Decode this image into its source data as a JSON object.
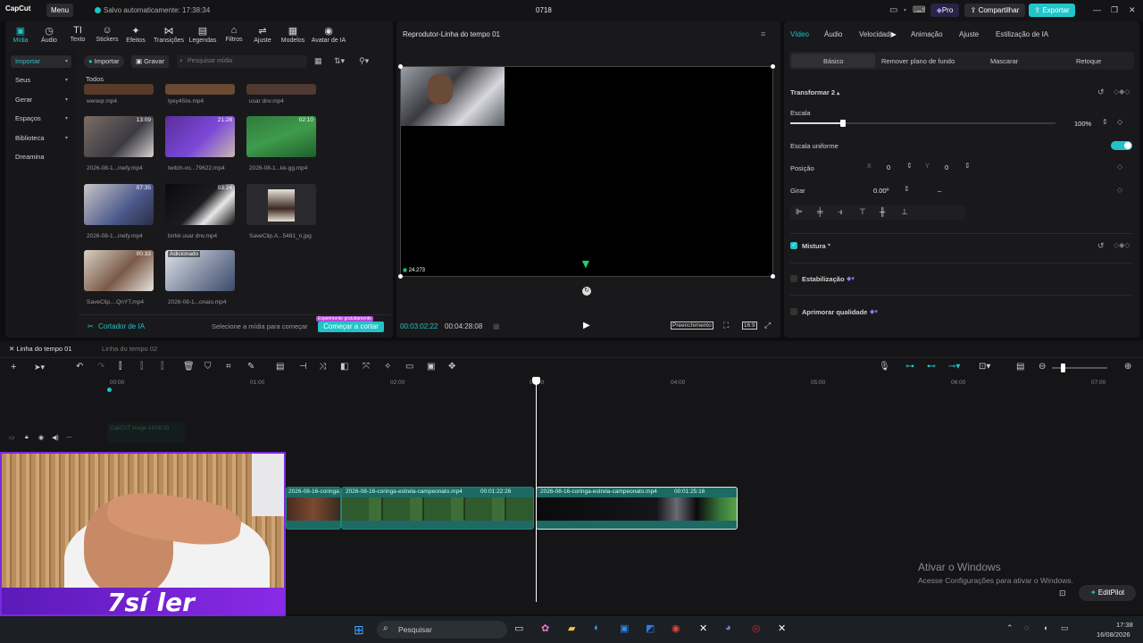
{
  "titlebar": {
    "logo": "CapCut",
    "menu_label": "Menu",
    "autosave": "Salvo automaticamente: 17:38:34",
    "doc_title": "0718",
    "pro_label": "Pro",
    "share_label": "Compartilhar",
    "export_label": "Exportar",
    "accent": "#22c6c9"
  },
  "tools": [
    {
      "label": "Mídia",
      "icon": "media-icon"
    },
    {
      "label": "Áudio",
      "icon": "audio-icon"
    },
    {
      "label": "Texto",
      "icon": "text-icon"
    },
    {
      "label": "Stickers",
      "icon": "sticker-icon"
    },
    {
      "label": "Efeitos",
      "icon": "effects-icon"
    },
    {
      "label": "Transições",
      "icon": "transitions-icon"
    },
    {
      "label": "Legendas",
      "icon": "captions-icon"
    },
    {
      "label": "Filtros",
      "icon": "filters-icon"
    },
    {
      "label": "Ajuste",
      "icon": "adjust-icon"
    },
    {
      "label": "Modelos",
      "icon": "templates-icon"
    },
    {
      "label": "Avatar de IA",
      "icon": "avatar-icon"
    }
  ],
  "categories": [
    "Importar",
    "Seus",
    "Gerar",
    "Espaços",
    "Biblioteca",
    "Dreamina"
  ],
  "media": {
    "import_label": "Importar",
    "record_label": "Gravar",
    "search_placeholder": "Pesquisar mídia",
    "section_label": "Todos",
    "items": [
      {
        "name": "wereqr.mp4",
        "duration": ""
      },
      {
        "name": "tyey4Sre.mp4",
        "duration": ""
      },
      {
        "name": "usar dnv.mp4",
        "duration": ""
      },
      {
        "name": "2026-08-1...inefy.mp4",
        "duration": "13:09"
      },
      {
        "name": "twitch-vo...79622.mp4",
        "duration": "21:28"
      },
      {
        "name": "2026-08-1...kk-gg.mp4",
        "duration": "02:10"
      },
      {
        "name": "2026-08-1...inefy.mp4",
        "duration": "07:35"
      },
      {
        "name": "brrkk usar dnv.mp4",
        "duration": "03:24"
      },
      {
        "name": "SaveClip.A...5481_n.jpg",
        "duration": ""
      },
      {
        "name": "SaveClip....QnYT.mp4",
        "duration": "00:33"
      },
      {
        "name": "2026-08-1...onaio.mp4",
        "duration": ""
      }
    ],
    "added_badge": "Adicionado",
    "cutter_label": "Cortador de IA",
    "select_hint": "Selecione a mídia para começar",
    "free_badge": "Experimente gratuitamente",
    "start_cut_label": "Começar a cortar"
  },
  "player": {
    "title": "Reprodutor-Linha do tempo 01",
    "current_time": "00:03:02:22",
    "total_time": "00:04:28:08",
    "fill_label": "Preenchimento",
    "ratio_label": "16:9",
    "overlay_text": "24.273"
  },
  "inspector": {
    "tabs": [
      "Vídeo",
      "Áudio",
      "Velocidade",
      "Animação",
      "Ajuste",
      "Estilização de IA"
    ],
    "subtabs": [
      "Básico",
      "Remover plano de fundo",
      "Mascarar",
      "Retoque"
    ],
    "transform_label": "Transformar 2",
    "scale_label": "Escala",
    "scale_value": "100%",
    "scale_fraction": 0.1,
    "uniform_scale_label": "Escala uniforme",
    "uniform_scale_on": true,
    "position_label": "Posição",
    "pos_x_label": "X",
    "pos_x": "0",
    "pos_y_label": "Y",
    "pos_y": "0",
    "rotate_label": "Girar",
    "rotate_value": "0.00º",
    "rotate_dash": "–",
    "blend_label": "Mistura",
    "blend_checked": true,
    "stabilize_label": "Estabilização",
    "enhance_label": "Aprimorar qualidade"
  },
  "timeline": {
    "tabs": [
      "Linha do tempo 01",
      "Linha do tempo 02"
    ],
    "ruler": [
      "00:00",
      "01:00",
      "02:00",
      "03:00",
      "04:00",
      "05:00",
      "06:00",
      "07:00"
    ],
    "overlay_track_label": "CapCUT image 14:08:20",
    "clips": [
      {
        "title": "2026-08-16-coringa",
        "duration": ""
      },
      {
        "title": "2026-08-16-coringa-estrela-campeonato.mp4",
        "duration": "00:01:22:26"
      },
      {
        "title": "2026-08-16-coringa-estrela-campeonato.mp4",
        "duration": "00:01:25:16"
      }
    ],
    "editpilot_label": "EditPilot"
  },
  "watermark": {
    "title": "Ativar o Windows",
    "subtitle": "Acesse Configurações para ativar o Windows."
  },
  "webcam": {
    "overlay_text": "7sí ler"
  },
  "taskbar": {
    "search_placeholder": "Pesquisar",
    "time": "17:38",
    "date": "16/08/2026"
  }
}
